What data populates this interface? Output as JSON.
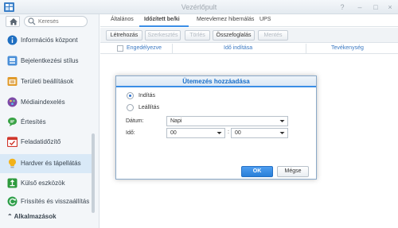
{
  "window": {
    "title": "Vezérlőpult",
    "controls": [
      "help-icon",
      "minimize-icon",
      "maximize-icon",
      "close-icon"
    ]
  },
  "sidebar": {
    "search_placeholder": "Keresés",
    "items": [
      {
        "label": "Információs központ",
        "icon": "info-icon",
        "color": "#1f6fc1"
      },
      {
        "label": "Bejelentkezési stílus",
        "icon": "login-style-icon",
        "color": "#4a8fd8"
      },
      {
        "label": "Területi beállítások",
        "icon": "regional-icon",
        "color": "#e09a2a"
      },
      {
        "label": "Médiaindexelés",
        "icon": "media-index-icon",
        "color": "#7d4aa8"
      },
      {
        "label": "Értesítés",
        "icon": "notification-icon",
        "color": "#3aa346"
      },
      {
        "label": "Feladatidőzítő",
        "icon": "task-scheduler-icon",
        "color": "#d0362b"
      },
      {
        "label": "Hardver és tápellátás",
        "icon": "hardware-power-icon",
        "color": "#f2b21a",
        "active": true
      },
      {
        "label": "Külső eszközök",
        "icon": "external-devices-icon",
        "color": "#2e9a3d"
      },
      {
        "label": "Frissítés és visszaállítás",
        "icon": "update-restore-icon",
        "color": "#2f9f4a"
      }
    ],
    "section_header": "Alkalmazások"
  },
  "tabs": [
    "Általános",
    "Időzített be/ki",
    "Merevlemez hibernálás",
    "UPS"
  ],
  "active_tab": "Időzített be/ki",
  "toolbar": {
    "create": "Létrehozás",
    "edit": "Szerkesztés",
    "delete": "Törlés",
    "summary": "Összefoglalás",
    "save": "Mentés"
  },
  "grid": {
    "columns": [
      "Engedélyezve",
      "Idő indítása",
      "Tevékenység"
    ]
  },
  "dialog": {
    "title": "Ütemezés hozzáadása",
    "radio_start": "Indítás",
    "radio_shutdown": "Leállítás",
    "date_label": "Dátum:",
    "date_value": "Napi",
    "time_label": "Idő:",
    "hour_value": "00",
    "minute_value": "00",
    "time_separator": ":",
    "ok": "OK",
    "cancel": "Mégse"
  },
  "colors": {
    "accent": "#3a8ee6",
    "active_nav": "#d9e9f7"
  }
}
